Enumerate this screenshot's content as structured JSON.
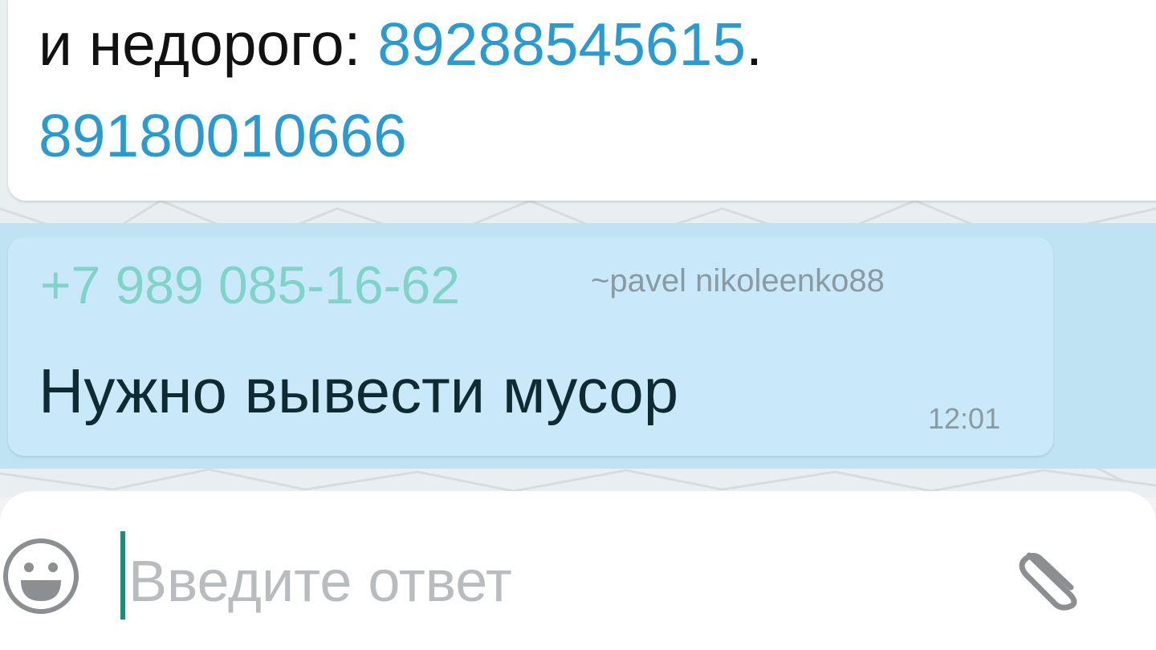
{
  "messages": {
    "incoming_top": {
      "text_prefix": "и недорого: ",
      "phone1": "89288545615",
      "separator": ".",
      "phone2": "89180010666"
    },
    "reply": {
      "sender_phone": "+7 989 085-16-62",
      "sender_nick": "~pavel nikoleenko88",
      "text": "Нужно вывести мусор",
      "time": "12:01"
    }
  },
  "composer": {
    "placeholder": "Введите ответ",
    "value": "",
    "emoji_icon": "emoji-smile-icon",
    "attach_icon": "paperclip-icon"
  },
  "colors": {
    "link": "#2b9ad1",
    "highlight": "#bfe3f3",
    "bubble_reply": "#c9e9fa",
    "sender_phone": "#7fd3c8",
    "caret": "#1a8f78"
  }
}
